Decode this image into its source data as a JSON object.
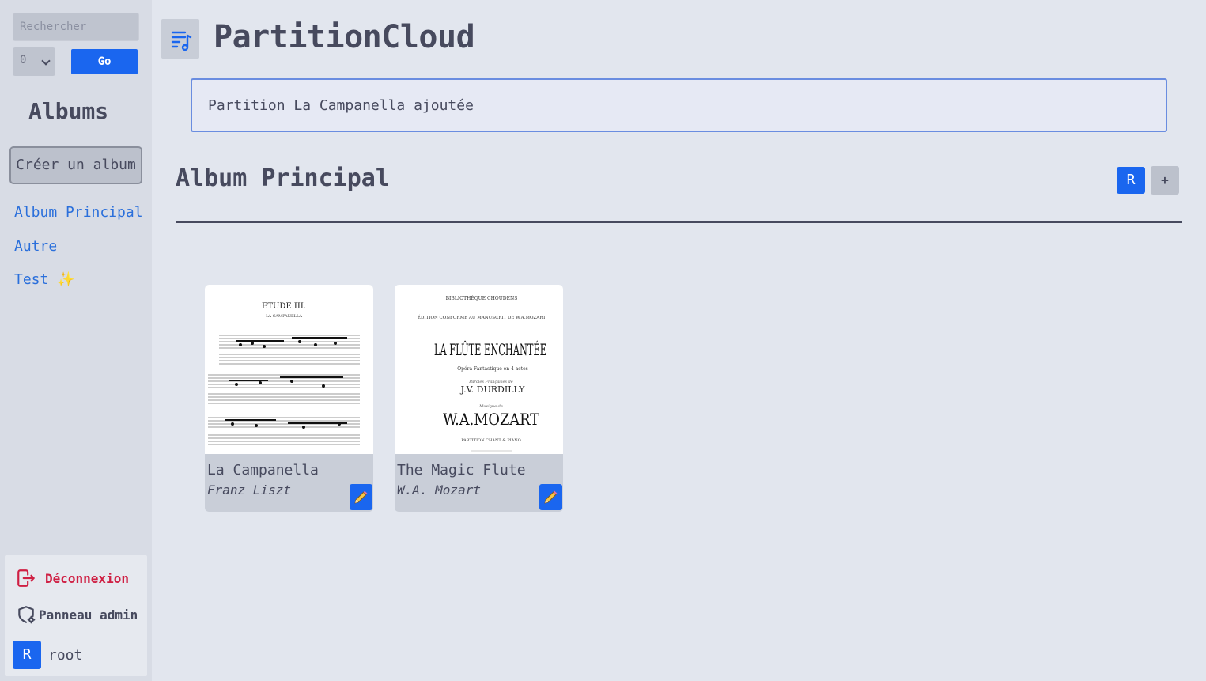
{
  "sidebar": {
    "search_placeholder": "Rechercher",
    "depth_value": "0",
    "go_label": "Go",
    "albums_title": "Albums",
    "create_album_label": "Créer un album",
    "albums": [
      {
        "label": "Album Principal"
      },
      {
        "label": "Autre"
      },
      {
        "label": "Test ✨"
      }
    ],
    "logout_label": "Déconnexion",
    "admin_label": "Panneau admin",
    "user": {
      "initial": "R",
      "name": "root"
    }
  },
  "header": {
    "app_title": "PartitionCloud"
  },
  "notification": {
    "text": "Partition La Campanella ajoutée"
  },
  "album": {
    "title": "Album Principal",
    "r_label": "R",
    "add_label": "+",
    "scores": [
      {
        "title": "La Campanella",
        "author": "Franz Liszt",
        "cover_text": [
          "ETUDE III.",
          "LA CAMPANELLA"
        ]
      },
      {
        "title": "The Magic Flute",
        "author": "W.A. Mozart",
        "cover_text": [
          "BIBLIOTHÈQUE CHOUDENS",
          "ÉDITION CONFORME AU MANUSCRIT DE W.A.MOZART",
          "LA FLÛTE ENCHANTÉE",
          "Opéra Fantastique en 4 actes",
          "Paroles Françaises de",
          "J.V. DURDILLY",
          "Musique de",
          "W.A.MOZART",
          "PARTITION CHANT & PIANO"
        ]
      }
    ]
  },
  "colors": {
    "accent": "#1a66ef",
    "danger": "#cf1f43",
    "link": "#2a6fdb",
    "background": "#e2e6ee"
  }
}
